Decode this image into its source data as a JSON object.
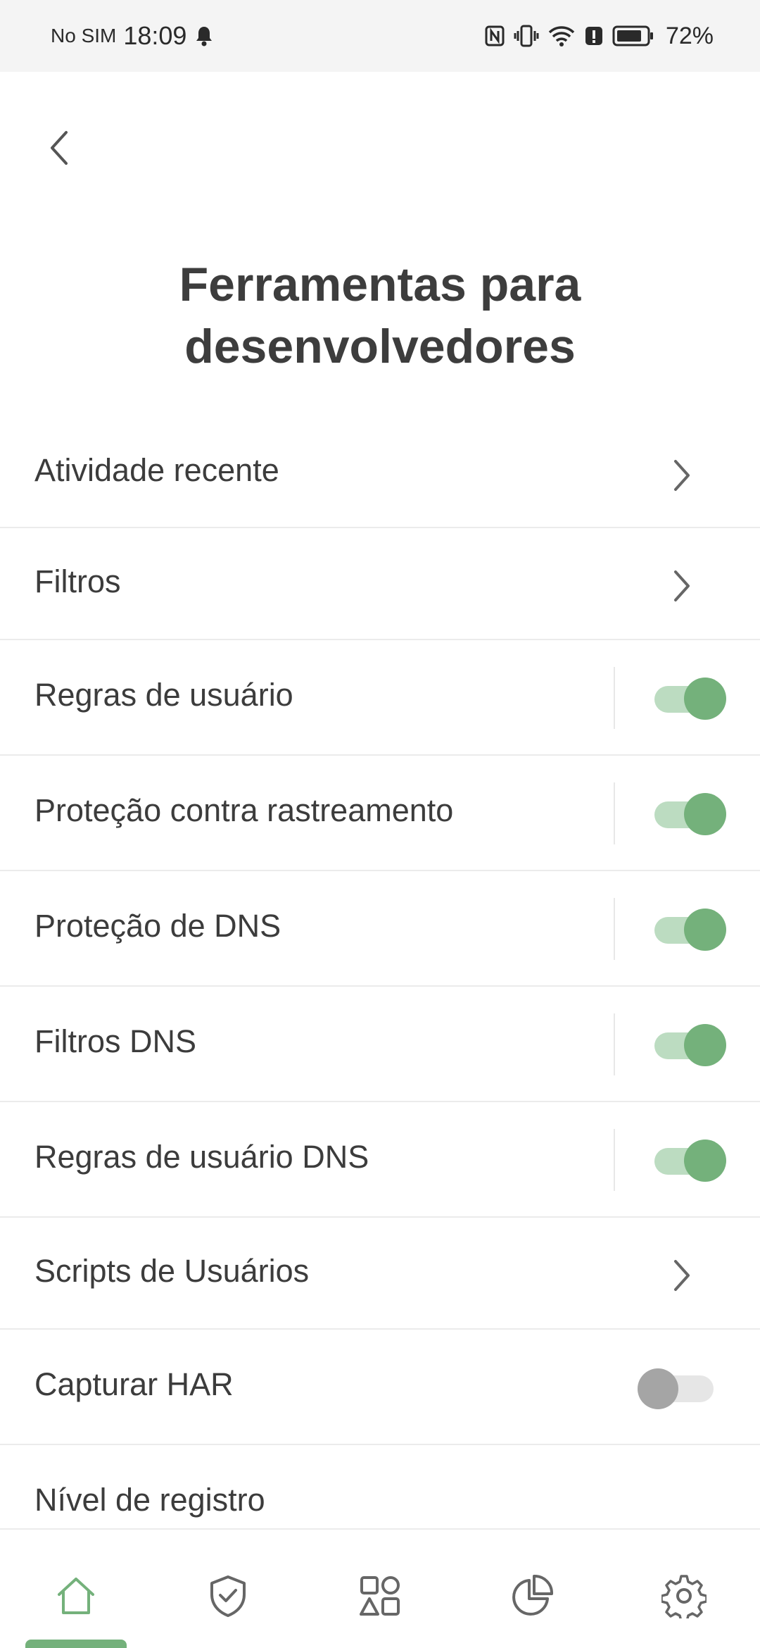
{
  "status_bar": {
    "carrier": "No SIM",
    "time": "18:09",
    "battery": "72%"
  },
  "header": {
    "title_line1": "Ferramentas para",
    "title_line2": "desenvolvedores"
  },
  "list": {
    "items": [
      {
        "label": "Atividade recente",
        "control": "chevron"
      },
      {
        "label": "Filtros",
        "control": "chevron"
      },
      {
        "label": "Regras de usuário",
        "control": "toggle",
        "on": true
      },
      {
        "label": "Proteção contra rastreamento",
        "control": "toggle",
        "on": true
      },
      {
        "label": "Proteção de DNS",
        "control": "toggle",
        "on": true
      },
      {
        "label": "Filtros DNS",
        "control": "toggle",
        "on": true
      },
      {
        "label": "Regras de usuário DNS",
        "control": "toggle",
        "on": true
      },
      {
        "label": "Scripts de Usuários",
        "control": "chevron"
      },
      {
        "label": "Capturar HAR",
        "control": "toggle",
        "on": false
      },
      {
        "label": "Nível de registro",
        "control": "none"
      }
    ]
  },
  "bottom_nav": {
    "items": [
      "home-icon",
      "shield-check-icon",
      "apps-icon",
      "statistics-icon",
      "settings-icon"
    ],
    "active": "home-icon"
  },
  "colors": {
    "accent": "#74b17b",
    "accent_light": "#bcdcc1",
    "toggle_off_knob": "#a5a5a5",
    "toggle_off_track": "#e6e6e6",
    "divider": "#ebebeb"
  }
}
